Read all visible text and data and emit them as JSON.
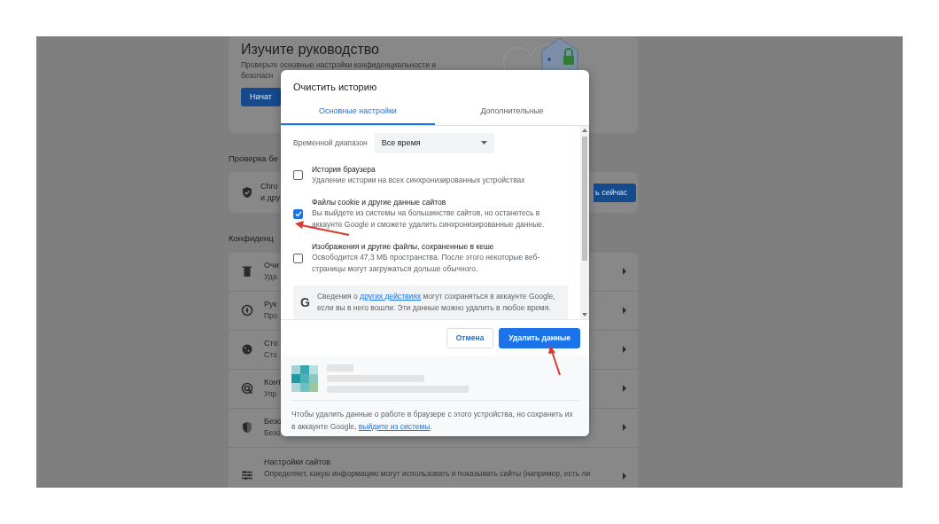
{
  "background_page": {
    "guide_card": {
      "title": "Изучите руководство",
      "description_lines": [
        "Проверьте основные настройки конфиденциальности и",
        "безопасн"
      ],
      "button": "Начат"
    },
    "safety_check": {
      "heading": "Проверка бе",
      "card_lines": [
        "Chro",
        "и дру"
      ],
      "button": "ь сейчас"
    },
    "privacy": {
      "heading": "Конфиденц",
      "rows": [
        {
          "title": "Очи",
          "subtitle": "Уда"
        },
        {
          "title": "Рук",
          "subtitle": "Про"
        },
        {
          "title": "Сто",
          "subtitle": "Сто"
        },
        {
          "title": "Конт",
          "subtitle": "Упр"
        },
        {
          "title": "Безо",
          "subtitle": "Безо"
        },
        {
          "title": "Настройки сайтов",
          "subtitle": "Определяет, какую информацию могут использовать и показывать сайты (например, есть ли"
        }
      ]
    }
  },
  "dialog": {
    "title": "Очистить историю",
    "tabs": [
      {
        "label": "Основные настройки",
        "selected": true
      },
      {
        "label": "Дополнительные",
        "selected": false
      }
    ],
    "time_range": {
      "label": "Временной диапазон",
      "value": "Все время"
    },
    "options": [
      {
        "title": "История браузера",
        "description": "Удаление истории на всех синхронизированных устройствах",
        "checked": false
      },
      {
        "title": "Файлы cookie и другие данные сайтов",
        "description": "Вы выйдете из системы на большинстве сайтов, но останетесь в аккаунте Google и сможете удалить синхронизированные данные.",
        "checked": true
      },
      {
        "title": "Изображения и другие файлы, сохраненные в кеше",
        "description": "Освободится 47,3 МБ пространства. После этого некоторые веб-страницы могут загружаться дольше обычного.",
        "checked": false
      }
    ],
    "google_notice": {
      "icon": "G",
      "text_before": "Сведения о ",
      "link": "других действиях",
      "text_after": " могут сохраняться в аккаунте Google, если вы в него вошли. Эти данные можно удалить в любое время."
    },
    "buttons": [
      {
        "label": "Отмена",
        "kind": "secondary"
      },
      {
        "label": "Удалить данные",
        "kind": "primary"
      }
    ],
    "footer": {
      "text_before": "Чтобы удалить данные о работе в браузере с этого устройства, но сохранить их в аккаунте Google, ",
      "link": "выйдите из системы",
      "text_after": "."
    }
  }
}
